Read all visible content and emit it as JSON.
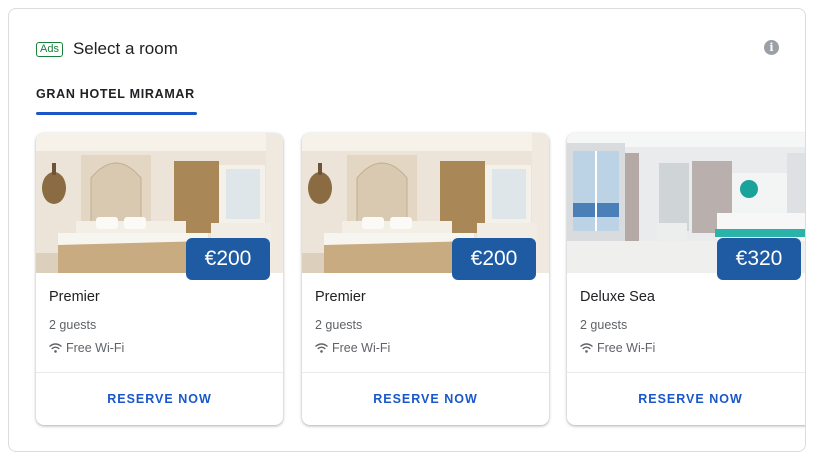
{
  "header": {
    "ads_label": "Ads",
    "title": "Select a room",
    "info_icon": "info-icon"
  },
  "tabs": [
    {
      "label": "GRAN HOTEL MIRAMAR",
      "selected": true
    }
  ],
  "colors": {
    "accent": "#1a57c9",
    "price_badge": "#1f5ba3",
    "ads_green": "#188038"
  },
  "rooms": [
    {
      "name": "Premier",
      "price": "€200",
      "guests": "2 guests",
      "amenity": "Free Wi-Fi",
      "amenity_icon": "wifi-icon",
      "action": "RESERVE NOW"
    },
    {
      "name": "Premier",
      "price": "€200",
      "guests": "2 guests",
      "amenity": "Free Wi-Fi",
      "amenity_icon": "wifi-icon",
      "action": "RESERVE NOW"
    },
    {
      "name": "Deluxe Sea",
      "price": "€320",
      "guests": "2 guests",
      "amenity": "Free Wi-Fi",
      "amenity_icon": "wifi-icon",
      "action": "RESERVE NOW"
    }
  ]
}
